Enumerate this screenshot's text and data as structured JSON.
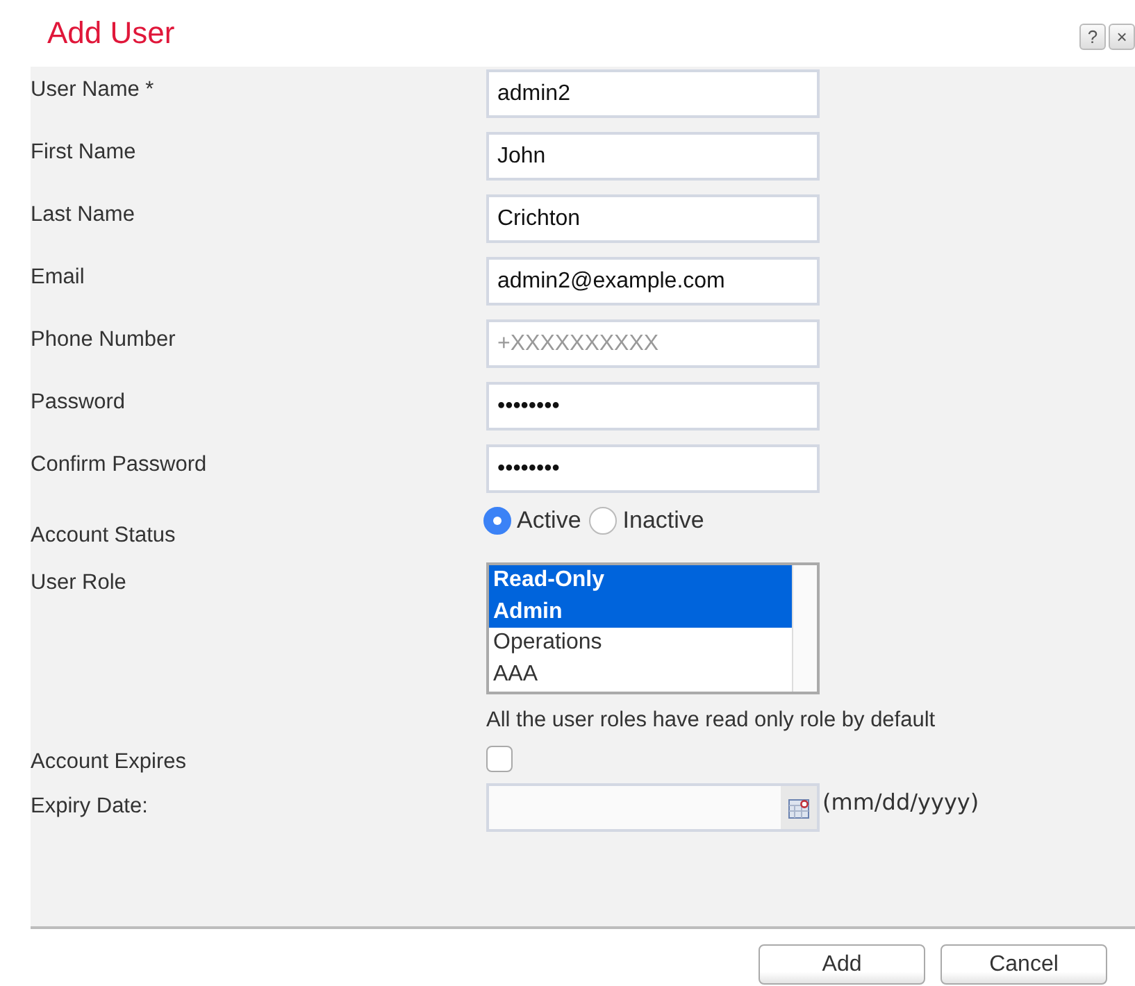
{
  "dialog": {
    "title": "Add User",
    "help_button": "?",
    "close_button": "×"
  },
  "fields": [
    {
      "kind": "text",
      "label": "User Name *",
      "value": "admin2"
    },
    {
      "kind": "text",
      "label": "First Name",
      "value": "John"
    },
    {
      "kind": "text",
      "label": "Last Name",
      "value": "Crichton"
    },
    {
      "kind": "text",
      "label": "Email",
      "value": "admin2@example.com"
    },
    {
      "kind": "text",
      "label": "Phone Number",
      "placeholder": "+XXXXXXXXXX"
    },
    {
      "kind": "text",
      "label": "Password",
      "value": "••••••••"
    },
    {
      "kind": "text",
      "label": "Confirm Password",
      "value": "••••••••"
    },
    {
      "kind": "radio",
      "label": "Account Status",
      "options": [
        {
          "label": "Active",
          "selected": true
        },
        {
          "label": "Inactive",
          "selected": false
        }
      ]
    },
    {
      "kind": "listbox",
      "label": "User Role",
      "options": [
        {
          "label": "Read-Only",
          "selected": true
        },
        {
          "label": "Admin",
          "selected": true
        },
        {
          "label": "Operations",
          "selected": false
        },
        {
          "label": "AAA",
          "selected": false
        }
      ],
      "note": "All the user roles have read only role by default"
    },
    {
      "kind": "checkbox",
      "label": "Account Expires",
      "checked": false
    },
    {
      "kind": "date",
      "label": "Expiry Date:",
      "hint": "(mm/dd/yyyy)"
    }
  ],
  "buttons": [
    "Add",
    "Cancel"
  ]
}
